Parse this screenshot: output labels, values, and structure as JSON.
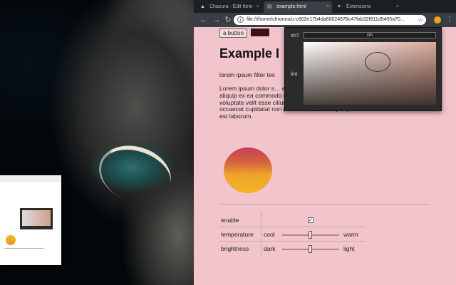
{
  "tabs": [
    {
      "label": "Chacura - Edit Item",
      "icon": "drive-icon"
    },
    {
      "label": "example.html",
      "icon": "page-icon"
    },
    {
      "label": "Extensions",
      "icon": "puzzle-icon"
    }
  ],
  "toolbar": {
    "url": "file:///home/chronos/u-c602e17b4da60024678c47fab32f811d5405a70...",
    "back_icon": "back-arrow-icon",
    "reload_icon": "reload-icon",
    "menu_icon": "kebab-menu-icon"
  },
  "page": {
    "button_label": "a button",
    "color_value": "#4a0d14",
    "title": "Example I",
    "filler": "lorem ipsum filler tex",
    "lorem_visible": "Lorem ipsum dolor s… eiusmod tempor incid… enim ad minim venia… nisi ut aliquip ex ea commodo consequat. Duis aute irure dolor in reprehenderit in voluptate velit esse cillum dolore eu fugiat nulla pariatur. Excepteur sint occaecat cupidatat non proident, sunt in culpa qui officia deserunt mollit anim id est laborum.",
    "controls": [
      {
        "label": "enable",
        "type": "checkbox",
        "checked": true,
        "check": "✓"
      },
      {
        "label": "temperature",
        "type": "slider",
        "min_label": "cool",
        "max_label": "warm",
        "value": 0.5
      },
      {
        "label": "brightness",
        "type": "slider",
        "min_label": "dark",
        "max_label": "light",
        "value": 0.5
      }
    ]
  },
  "popup": {
    "on_label": "on?",
    "on_button": "on",
    "tint_label": "tint"
  },
  "colors": {
    "page_bg": "#f2c4cb",
    "accent": "#f0a020"
  }
}
